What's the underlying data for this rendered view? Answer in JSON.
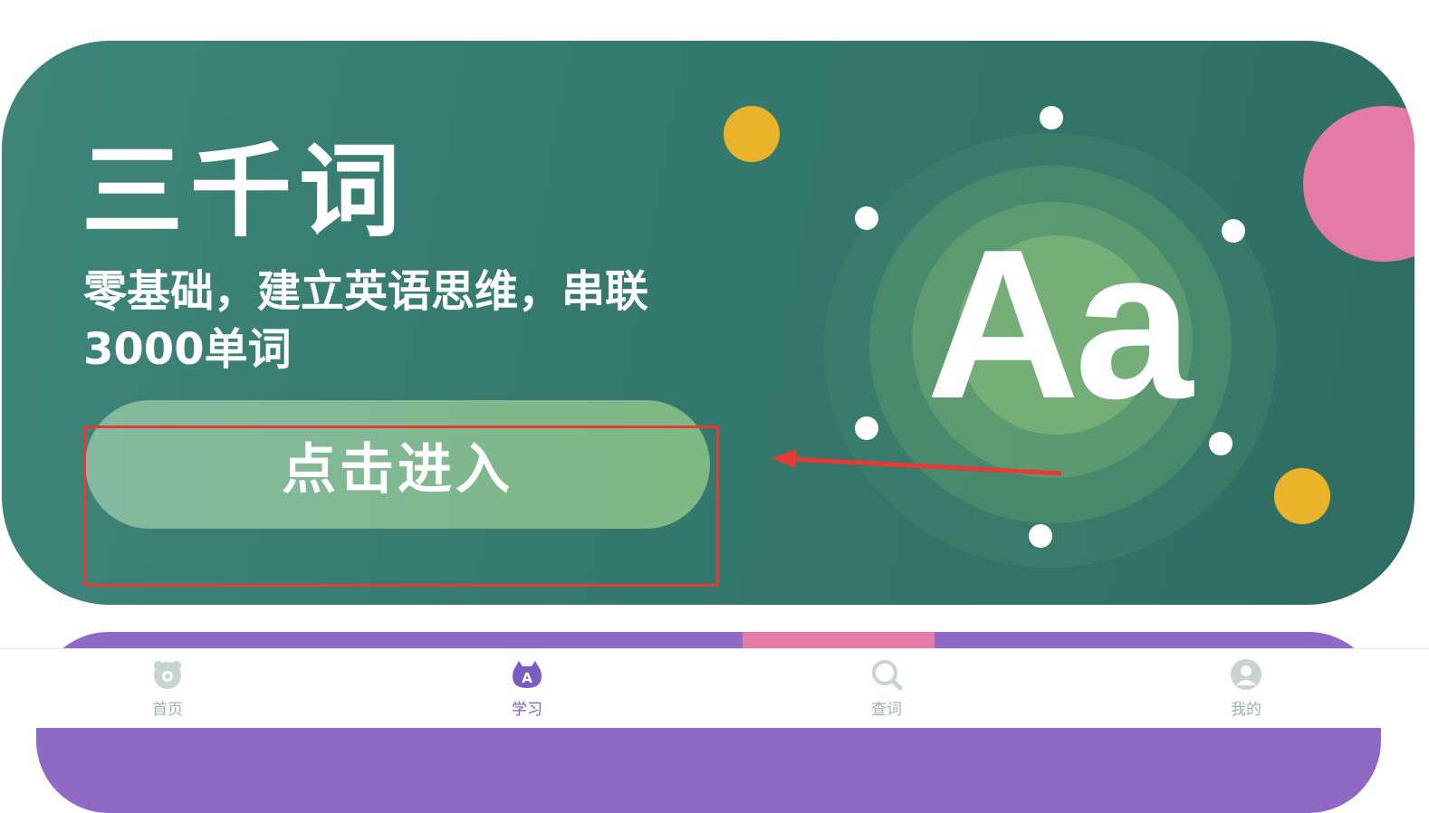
{
  "hero": {
    "title": "三千词",
    "subtitle": "零基础，建立英语思维，串联3000单词",
    "button_label": "点击进入",
    "logo_text": "Aa"
  },
  "tabbar": {
    "tabs": [
      {
        "label": "首页",
        "icon": "home-icon",
        "active": false
      },
      {
        "label": "学习",
        "icon": "study-icon",
        "active": true
      },
      {
        "label": "查词",
        "icon": "search-icon",
        "active": false
      },
      {
        "label": "我的",
        "icon": "profile-icon",
        "active": false
      }
    ]
  },
  "colors": {
    "card_bg": "#367a6e",
    "button_bg": "#7db883",
    "accent_yellow": "#eab42a",
    "accent_pink": "#e47aa6",
    "active_tab": "#7a5cc4",
    "annotation_red": "#e63a36"
  }
}
